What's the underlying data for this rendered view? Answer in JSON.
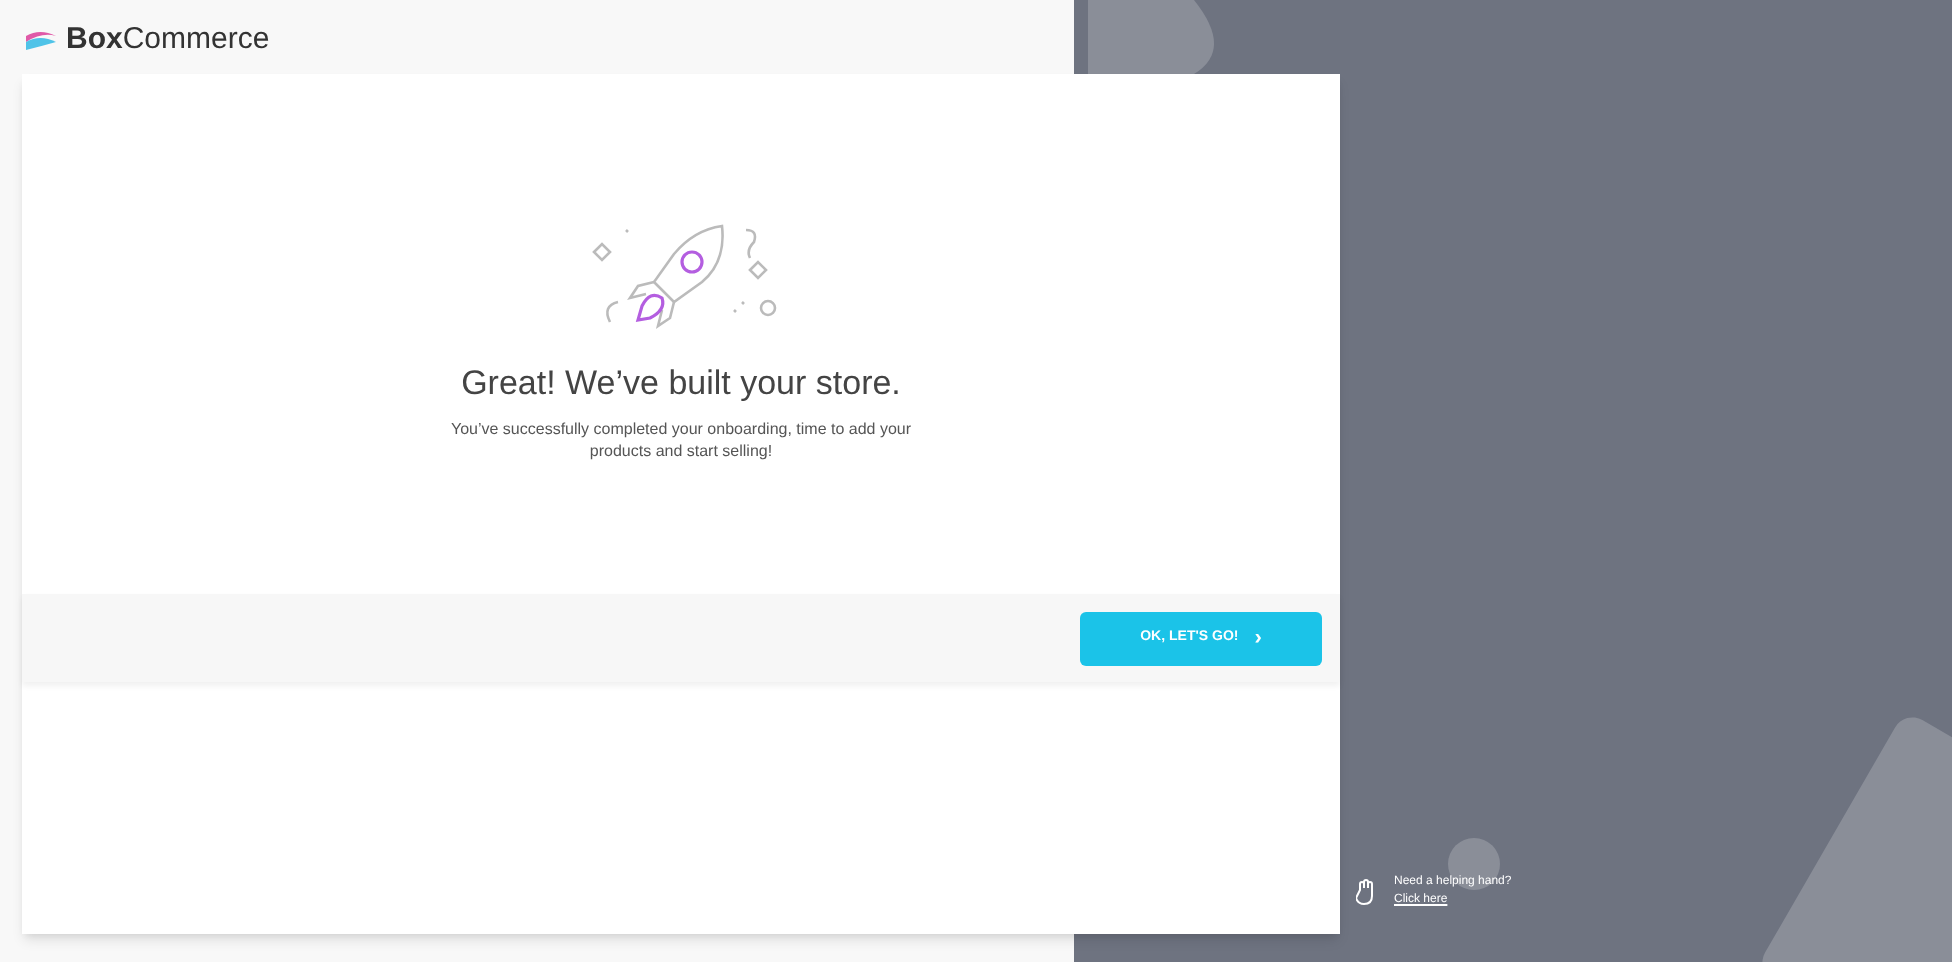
{
  "logo": {
    "text": "**Box**Commerce"
  },
  "dialog": {
    "title": "Great! We’ve built your store.",
    "message": "You’ve successfully completed your onboarding, time to add your products and start selling!",
    "button": {
      "label": "OK, LET'S GO!",
      "icon": "›"
    }
  },
  "help": {
    "text": "Need a helping hand?",
    "link": "Click here"
  }
}
